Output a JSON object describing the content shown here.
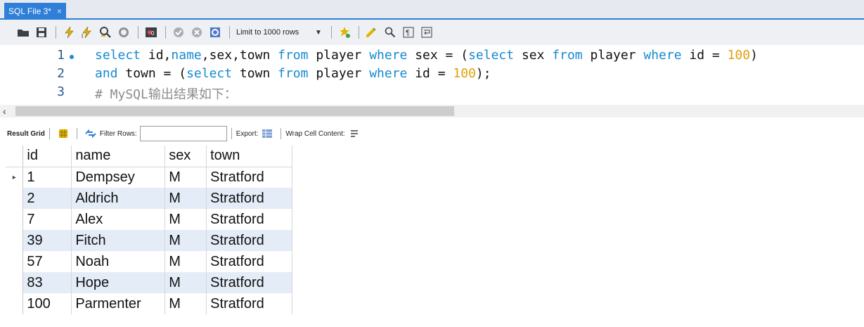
{
  "tab": {
    "title": "SQL File 3*",
    "close": "×"
  },
  "toolbar": {
    "limit_label": "Limit to 1000 rows",
    "icons": [
      "folder-icon",
      "save-icon",
      "execute-icon",
      "execute-current-icon",
      "explain-icon",
      "stop-icon",
      "toggle-output-icon",
      "commit-icon",
      "rollback-icon",
      "autocommit-icon",
      "beautify-icon",
      "find-icon",
      "invisible-chars-icon",
      "wrap-icon"
    ]
  },
  "editor": {
    "line_numbers": [
      "1",
      "2",
      "3"
    ],
    "comment": "# MySQL输出结果如下："
  },
  "result_bar": {
    "title": "Result Grid",
    "filter_label": "Filter Rows:",
    "filter_value": "",
    "export_label": "Export:",
    "wrap_label": "Wrap Cell Content:"
  },
  "grid": {
    "columns": [
      "id",
      "name",
      "sex",
      "town"
    ],
    "rows": [
      [
        "1",
        "Dempsey",
        "M",
        "Stratford"
      ],
      [
        "2",
        "Aldrich",
        "M",
        "Stratford"
      ],
      [
        "7",
        "Alex",
        "M",
        "Stratford"
      ],
      [
        "39",
        "Fitch",
        "M",
        "Stratford"
      ],
      [
        "57",
        "Noah",
        "M",
        "Stratford"
      ],
      [
        "83",
        "Hope",
        "M",
        "Stratford"
      ],
      [
        "100",
        "Parmenter",
        "M",
        "Stratford"
      ]
    ],
    "current_row_marker": "▸"
  },
  "colors": {
    "accent": "#2f7fd8",
    "keyword": "#1689d0",
    "number": "#e1a00b",
    "alt_row": "#e4ecf7"
  }
}
